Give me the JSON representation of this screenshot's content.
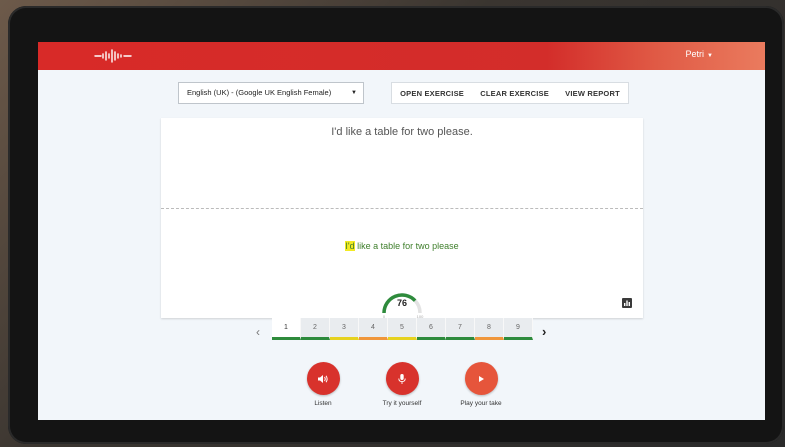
{
  "header": {
    "user_name": "Petri"
  },
  "toolbar": {
    "language": "English (UK) - (Google UK English Female)",
    "open_exercise": "OPEN EXERCISE",
    "clear_exercise": "CLEAR EXERCISE",
    "view_report": "VIEW REPORT"
  },
  "exercise": {
    "target_sentence": "I'd like a table for two please.",
    "recognized_highlight": "I'd",
    "recognized_rest": " like a table for two please"
  },
  "score": {
    "value": "76",
    "min": "0",
    "max": "100",
    "fraction": 0.76,
    "color": "#2e8b3c"
  },
  "pager": {
    "prev": "‹",
    "next": "›",
    "pages": [
      {
        "label": "1",
        "color": "#2e8b3c",
        "active": true
      },
      {
        "label": "2",
        "color": "#2e8b3c"
      },
      {
        "label": "3",
        "color": "#e6d21f"
      },
      {
        "label": "4",
        "color": "#f0963a"
      },
      {
        "label": "5",
        "color": "#e6d21f"
      },
      {
        "label": "6",
        "color": "#2e8b3c"
      },
      {
        "label": "7",
        "color": "#2e8b3c"
      },
      {
        "label": "8",
        "color": "#f0963a"
      },
      {
        "label": "9",
        "color": "#2e8b3c"
      }
    ]
  },
  "controls": {
    "listen": {
      "label": "Listen",
      "icon": "speaker-icon",
      "color": "#d8322c"
    },
    "try": {
      "label": "Try it yourself",
      "icon": "microphone-icon",
      "color": "#d8322c"
    },
    "play": {
      "label": "Play your take",
      "icon": "play-icon",
      "color": "#e6553b"
    }
  },
  "colors": {
    "brand": "#d82a28"
  }
}
